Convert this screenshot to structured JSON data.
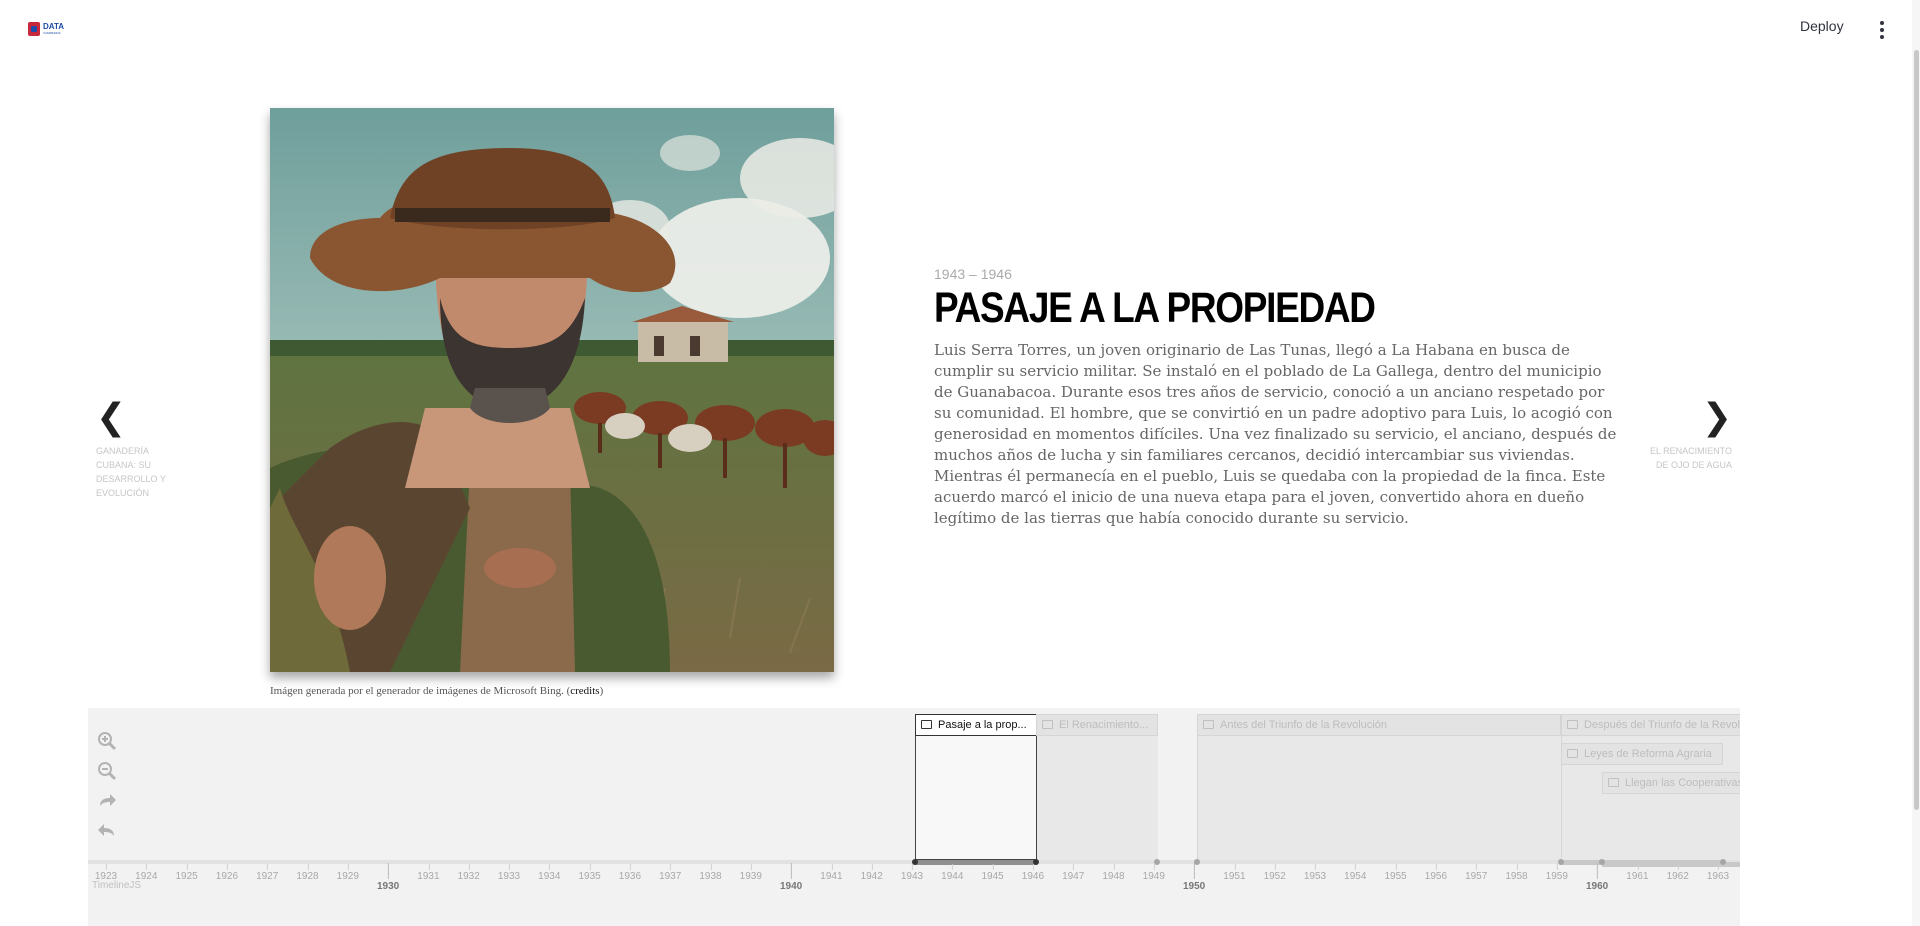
{
  "app": {
    "deploy_label": "Deploy",
    "logo_text_top": "DATA",
    "logo_text_bottom": "CAMPESINA"
  },
  "slide": {
    "date": "1943 – 1946",
    "headline": "PASAJE A LA PROPIEDAD",
    "body": "Luis Serra Torres, un joven originario de Las Tunas, llegó a La Habana en busca de cumplir su servicio militar. Se instaló en el poblado de La Gallega, dentro del municipio de Guanabacoa. Durante esos tres años de servicio, conoció a un anciano respetado por su comunidad. El hombre, que se convirtió en un padre adoptivo para Luis, lo acogió con generosidad en momentos difíciles. Una vez finalizado su servicio, el anciano, después de muchos años de lucha y sin familiares cercanos, decidió intercambiar sus viviendas. Mientras él permanecía en el pueblo, Luis se quedaba con la propiedad de la finca. Este acuerdo marcó el inicio de una nueva etapa para el joven, convertido ahora en dueño legítimo de las tierras que había conocido durante su servicio.",
    "caption_text": "Imágen generada por el generador de imágenes de Microsoft Bing. (",
    "caption_link": "credits",
    "caption_end": ")"
  },
  "nav": {
    "prev_label": "GANADERÍA CUBANA: SU DESARROLLO Y EVOLUCIÓN",
    "next_label": "EL RENACIMIENTO DE OJO DE AGUA"
  },
  "timeline": {
    "markers": [
      {
        "label": "Pasaje a la prop..."
      },
      {
        "label": "El Renacimiento..."
      },
      {
        "label": "Antes del Triunfo de la Revolución"
      },
      {
        "label": "Después del Triunfo de la Revolución"
      },
      {
        "label": "Leyes de Reforma Agraria"
      },
      {
        "label": "Llegan las Cooperativas"
      }
    ],
    "years": [
      "1923",
      "1924",
      "1925",
      "1926",
      "1927",
      "1928",
      "1929",
      "1931",
      "1932",
      "1933",
      "1934",
      "1935",
      "1936",
      "1937",
      "1938",
      "1939",
      "1941",
      "1942",
      "1943",
      "1944",
      "1945",
      "1946",
      "1947",
      "1948",
      "1949",
      "1951",
      "1952",
      "1953",
      "1954",
      "1955",
      "1956",
      "1957",
      "1958",
      "1959",
      "1961",
      "1962",
      "1963"
    ],
    "decades": [
      "1930",
      "1940",
      "1950",
      "1960"
    ],
    "credit": "TimelineJS"
  },
  "icons": {
    "zoom_in": "zoom-in-icon",
    "zoom_out": "zoom-out-icon",
    "redo": "redo-icon",
    "undo": "undo-icon"
  }
}
